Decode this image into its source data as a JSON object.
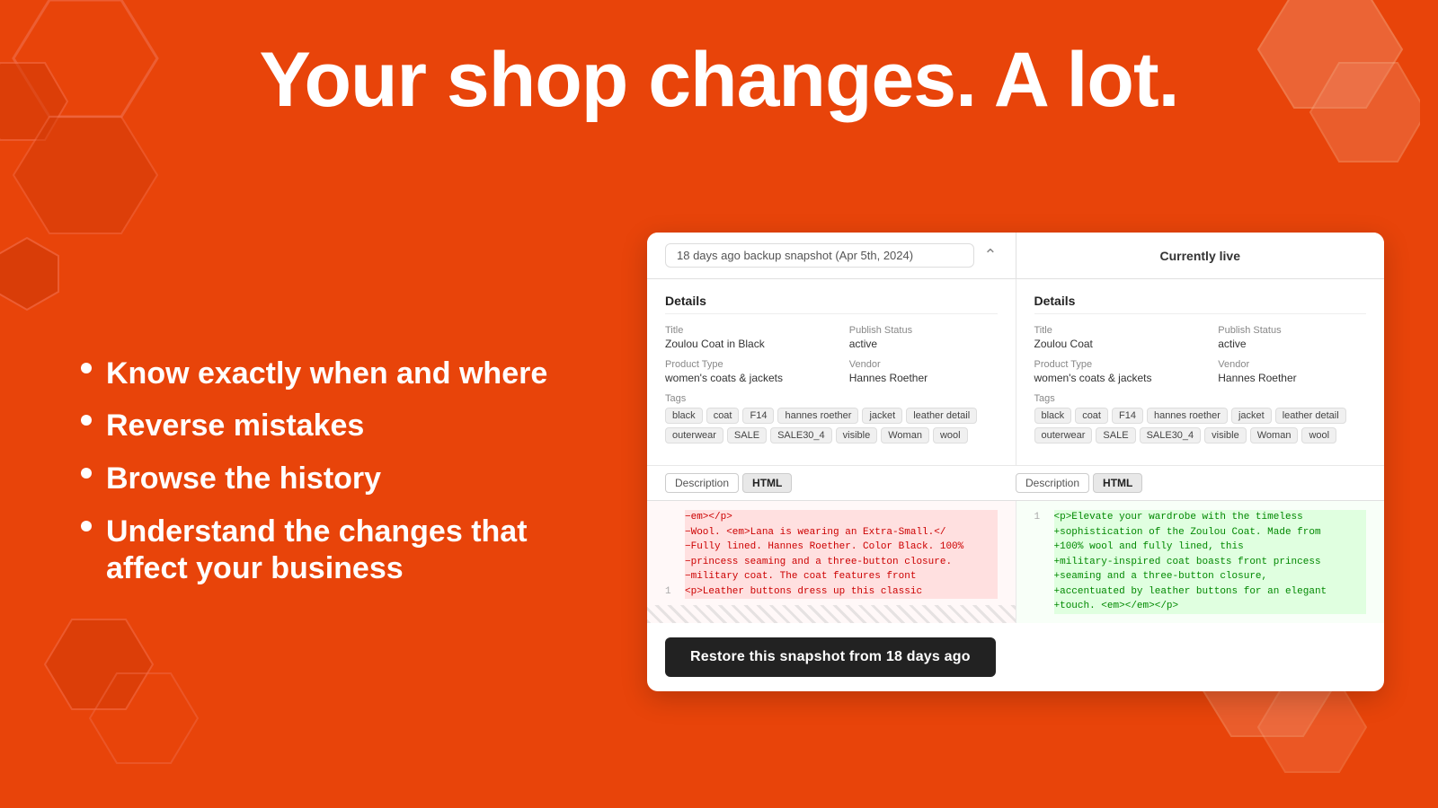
{
  "title": "Your shop changes. A lot.",
  "bullets": [
    {
      "id": "know",
      "text": "Know exactly when and where"
    },
    {
      "id": "reverse",
      "text": "Reverse mistakes"
    },
    {
      "id": "browse",
      "text": "Browse the history"
    },
    {
      "id": "understand",
      "text": "Understand the changes that affect your business"
    }
  ],
  "comparison": {
    "snapshot_label": "18 days ago backup snapshot (Apr 5th, 2024)",
    "live_label": "Currently live",
    "left": {
      "section_title": "Details",
      "title_label": "Title",
      "title_value": "Zoulou Coat in Black",
      "publish_label": "Publish Status",
      "publish_value": "active",
      "product_type_label": "Product Type",
      "product_type_value": "women's coats & jackets",
      "vendor_label": "Vendor",
      "vendor_value": "Hannes Roether",
      "tags_label": "Tags",
      "tags": [
        "black",
        "coat",
        "F14",
        "hannes roether",
        "jacket",
        "leather detail",
        "outerwear",
        "SALE",
        "SALE30_4",
        "visible",
        "Woman",
        "wool"
      ],
      "desc_tab1": "Description",
      "desc_tab2": "HTML",
      "code_lines": [
        {
          "num": "1",
          "type": "del",
          "content": "<p>Leather buttons dress up this classic"
        },
        {
          "num": "",
          "type": "del",
          "content": "−military coat. The coat features front"
        },
        {
          "num": "",
          "type": "del",
          "content": "−princess seaming and a three-button closure."
        },
        {
          "num": "",
          "type": "del",
          "content": "−Fully lined. Hannes Roether. Color Black. 100%"
        },
        {
          "num": "",
          "type": "del",
          "content": "−Wool. <em>Lana is wearing an Extra-Small.</"
        },
        {
          "num": "",
          "type": "del",
          "content": "−em></p>"
        }
      ]
    },
    "right": {
      "section_title": "Details",
      "title_label": "Title",
      "title_value": "Zoulou Coat",
      "publish_label": "Publish Status",
      "publish_value": "active",
      "product_type_label": "Product Type",
      "product_type_value": "women's coats & jackets",
      "vendor_label": "Vendor",
      "vendor_value": "Hannes Roether",
      "tags_label": "Tags",
      "tags": [
        "black",
        "coat",
        "F14",
        "hannes roether",
        "jacket",
        "leather detail",
        "outerwear",
        "SALE",
        "SALE30_4",
        "visible",
        "Woman",
        "wool"
      ],
      "desc_tab1": "Description",
      "desc_tab2": "HTML",
      "code_lines": [
        {
          "num": "1",
          "type": "add",
          "content": "<p>Elevate your wardrobe with the timeless"
        },
        {
          "num": "",
          "type": "add",
          "content": "+sophistication of the Zoulou Coat. Made from"
        },
        {
          "num": "",
          "type": "add",
          "content": "+100% wool and fully lined, this"
        },
        {
          "num": "",
          "type": "add",
          "content": "+military-inspired coat boasts front princess"
        },
        {
          "num": "",
          "type": "add",
          "content": "+seaming and a three-button closure,"
        },
        {
          "num": "",
          "type": "add",
          "content": "+accentuated by leather buttons for an elegant"
        },
        {
          "num": "",
          "type": "add",
          "content": "+touch. <em></em></p>"
        }
      ]
    },
    "restore_button_label": "Restore this snapshot from 18 days ago"
  },
  "colors": {
    "bg": "#e8440a",
    "accent_light": "#f06030",
    "hex_stroke": "#f07050"
  }
}
